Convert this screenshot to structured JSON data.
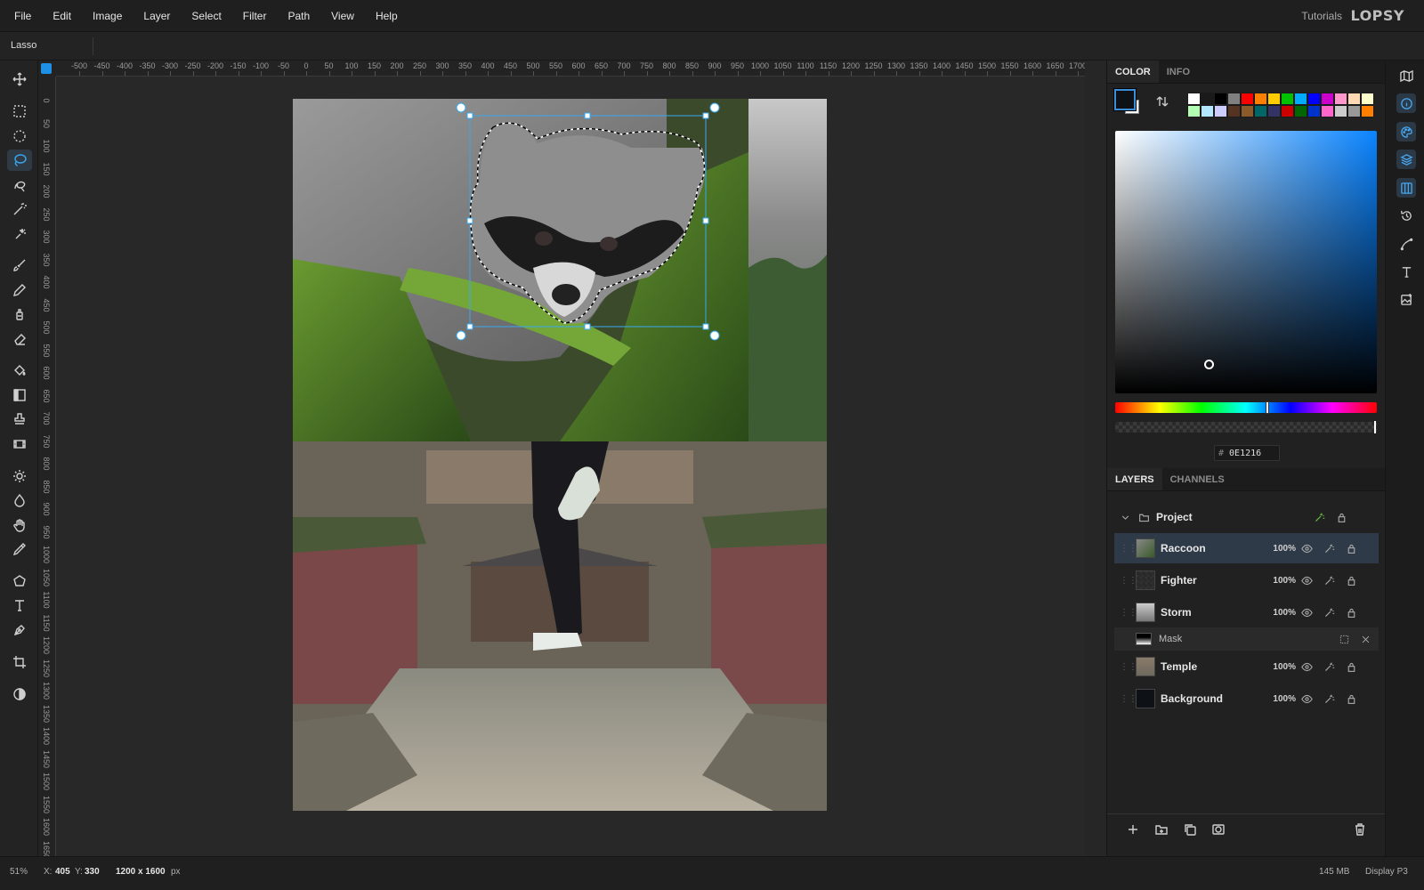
{
  "menubar": {
    "items": [
      "File",
      "Edit",
      "Image",
      "Layer",
      "Select",
      "Filter",
      "Path",
      "View",
      "Help"
    ],
    "tutorials": "Tutorials",
    "logo": "LOPSY"
  },
  "tool_options": {
    "tool_name": "Lasso"
  },
  "toolbar": {
    "tools": [
      {
        "icon": "move-icon",
        "active": false
      },
      {
        "icon": "rect-select-icon",
        "active": false
      },
      {
        "icon": "ellipse-select-icon",
        "active": false
      },
      {
        "icon": "lasso-icon",
        "active": true
      },
      {
        "icon": "object-select-icon",
        "active": false
      },
      {
        "icon": "magic-wand-icon",
        "active": false
      },
      {
        "icon": "quick-select-icon",
        "active": false
      },
      {
        "icon": "brush-icon",
        "active": false
      },
      {
        "icon": "pencil-icon",
        "active": false
      },
      {
        "icon": "clone-icon",
        "active": false
      },
      {
        "icon": "eraser-icon",
        "active": false
      },
      {
        "icon": "fill-bucket-icon",
        "active": false
      },
      {
        "icon": "gradient-icon",
        "active": false
      },
      {
        "icon": "stamp-icon",
        "active": false
      },
      {
        "icon": "filmstrip-icon",
        "active": false
      },
      {
        "icon": "dodge-icon",
        "active": false
      },
      {
        "icon": "blur-icon",
        "active": false
      },
      {
        "icon": "hand-icon",
        "active": false
      },
      {
        "icon": "eyedropper-icon",
        "active": false
      },
      {
        "icon": "polygon-icon",
        "active": false
      },
      {
        "icon": "text-icon",
        "active": false
      },
      {
        "icon": "pen-icon",
        "active": false
      },
      {
        "icon": "crop-icon",
        "active": false
      },
      {
        "icon": "contrast-icon",
        "active": false
      }
    ]
  },
  "rulers": {
    "h_labels": [
      "-500",
      "-450",
      "-400",
      "-350",
      "-300",
      "-250",
      "-200",
      "-150",
      "-100",
      "-50",
      "0",
      "50",
      "100",
      "150",
      "200",
      "250",
      "300",
      "350",
      "400",
      "450",
      "500",
      "550",
      "600",
      "650",
      "700",
      "750",
      "800",
      "850",
      "900",
      "950",
      "1000",
      "1050",
      "1100",
      "1150",
      "1200",
      "1250",
      "1300",
      "1350",
      "1400",
      "1450",
      "1500",
      "1550",
      "1600",
      "1650",
      "1700",
      "17"
    ],
    "v_labels": [
      "0",
      "50",
      "100",
      "150",
      "200",
      "250",
      "300",
      "350",
      "400",
      "450",
      "500",
      "550",
      "600",
      "650",
      "700",
      "750",
      "800",
      "850",
      "900",
      "950",
      "1000",
      "1050",
      "1100",
      "1150",
      "1200",
      "1250",
      "1300",
      "1350",
      "1400",
      "1450",
      "1500",
      "1550",
      "1600",
      "1650"
    ]
  },
  "status": {
    "zoom": "51%",
    "x_label": "X:",
    "x_value": "405",
    "y_label": "Y:",
    "y_value": "330",
    "doc_size": "1200 x 1600",
    "doc_unit": "px",
    "memory": "145 MB",
    "profile": "Display P3"
  },
  "color_panel": {
    "tabs": [
      "COLOR",
      "INFO"
    ],
    "active_tab": "COLOR",
    "foreground": "#0E1216",
    "background": "#FFFFFF",
    "hex_value": "0E1216",
    "hue_position": 0.58,
    "swatches": [
      "#ffffff",
      "#1a1a1a",
      "#000000",
      "#808080",
      "#ff0000",
      "#ff7f00",
      "#ffcc00",
      "#00c000",
      "#00aaff",
      "#0000ff",
      "#cc00cc",
      "#ff99cc",
      "#ffd9b3",
      "#ffffcc",
      "#b3ffb3",
      "#b3e6ff",
      "#ccccff",
      "#553322",
      "#8b5a2b",
      "#006666",
      "#333366",
      "#cc0000",
      "#006600",
      "#0033cc",
      "#ff66cc",
      "#cccccc",
      "#999999",
      "#ff8000"
    ]
  },
  "layers_panel": {
    "tabs": [
      "LAYERS",
      "CHANNELS"
    ],
    "active_tab": "LAYERS",
    "group": {
      "name": "Project"
    },
    "layers": [
      {
        "name": "Raccoon",
        "opacity": "100%",
        "selected": true
      },
      {
        "name": "Fighter",
        "opacity": "100%",
        "selected": false
      },
      {
        "name": "Storm",
        "opacity": "100%",
        "selected": false
      }
    ],
    "mask": {
      "name": "Mask"
    },
    "layers_after": [
      {
        "name": "Temple",
        "opacity": "100%",
        "selected": false
      },
      {
        "name": "Background",
        "opacity": "100%",
        "selected": false
      }
    ]
  },
  "right_strip": {
    "icons": [
      "map-icon",
      "info-icon",
      "palette-icon",
      "layers-icon",
      "columns-icon",
      "history-icon",
      "curve-icon",
      "text-icon",
      "image-adjust-icon"
    ],
    "active": [
      "info-icon",
      "palette-icon",
      "layers-icon",
      "columns-icon"
    ]
  }
}
